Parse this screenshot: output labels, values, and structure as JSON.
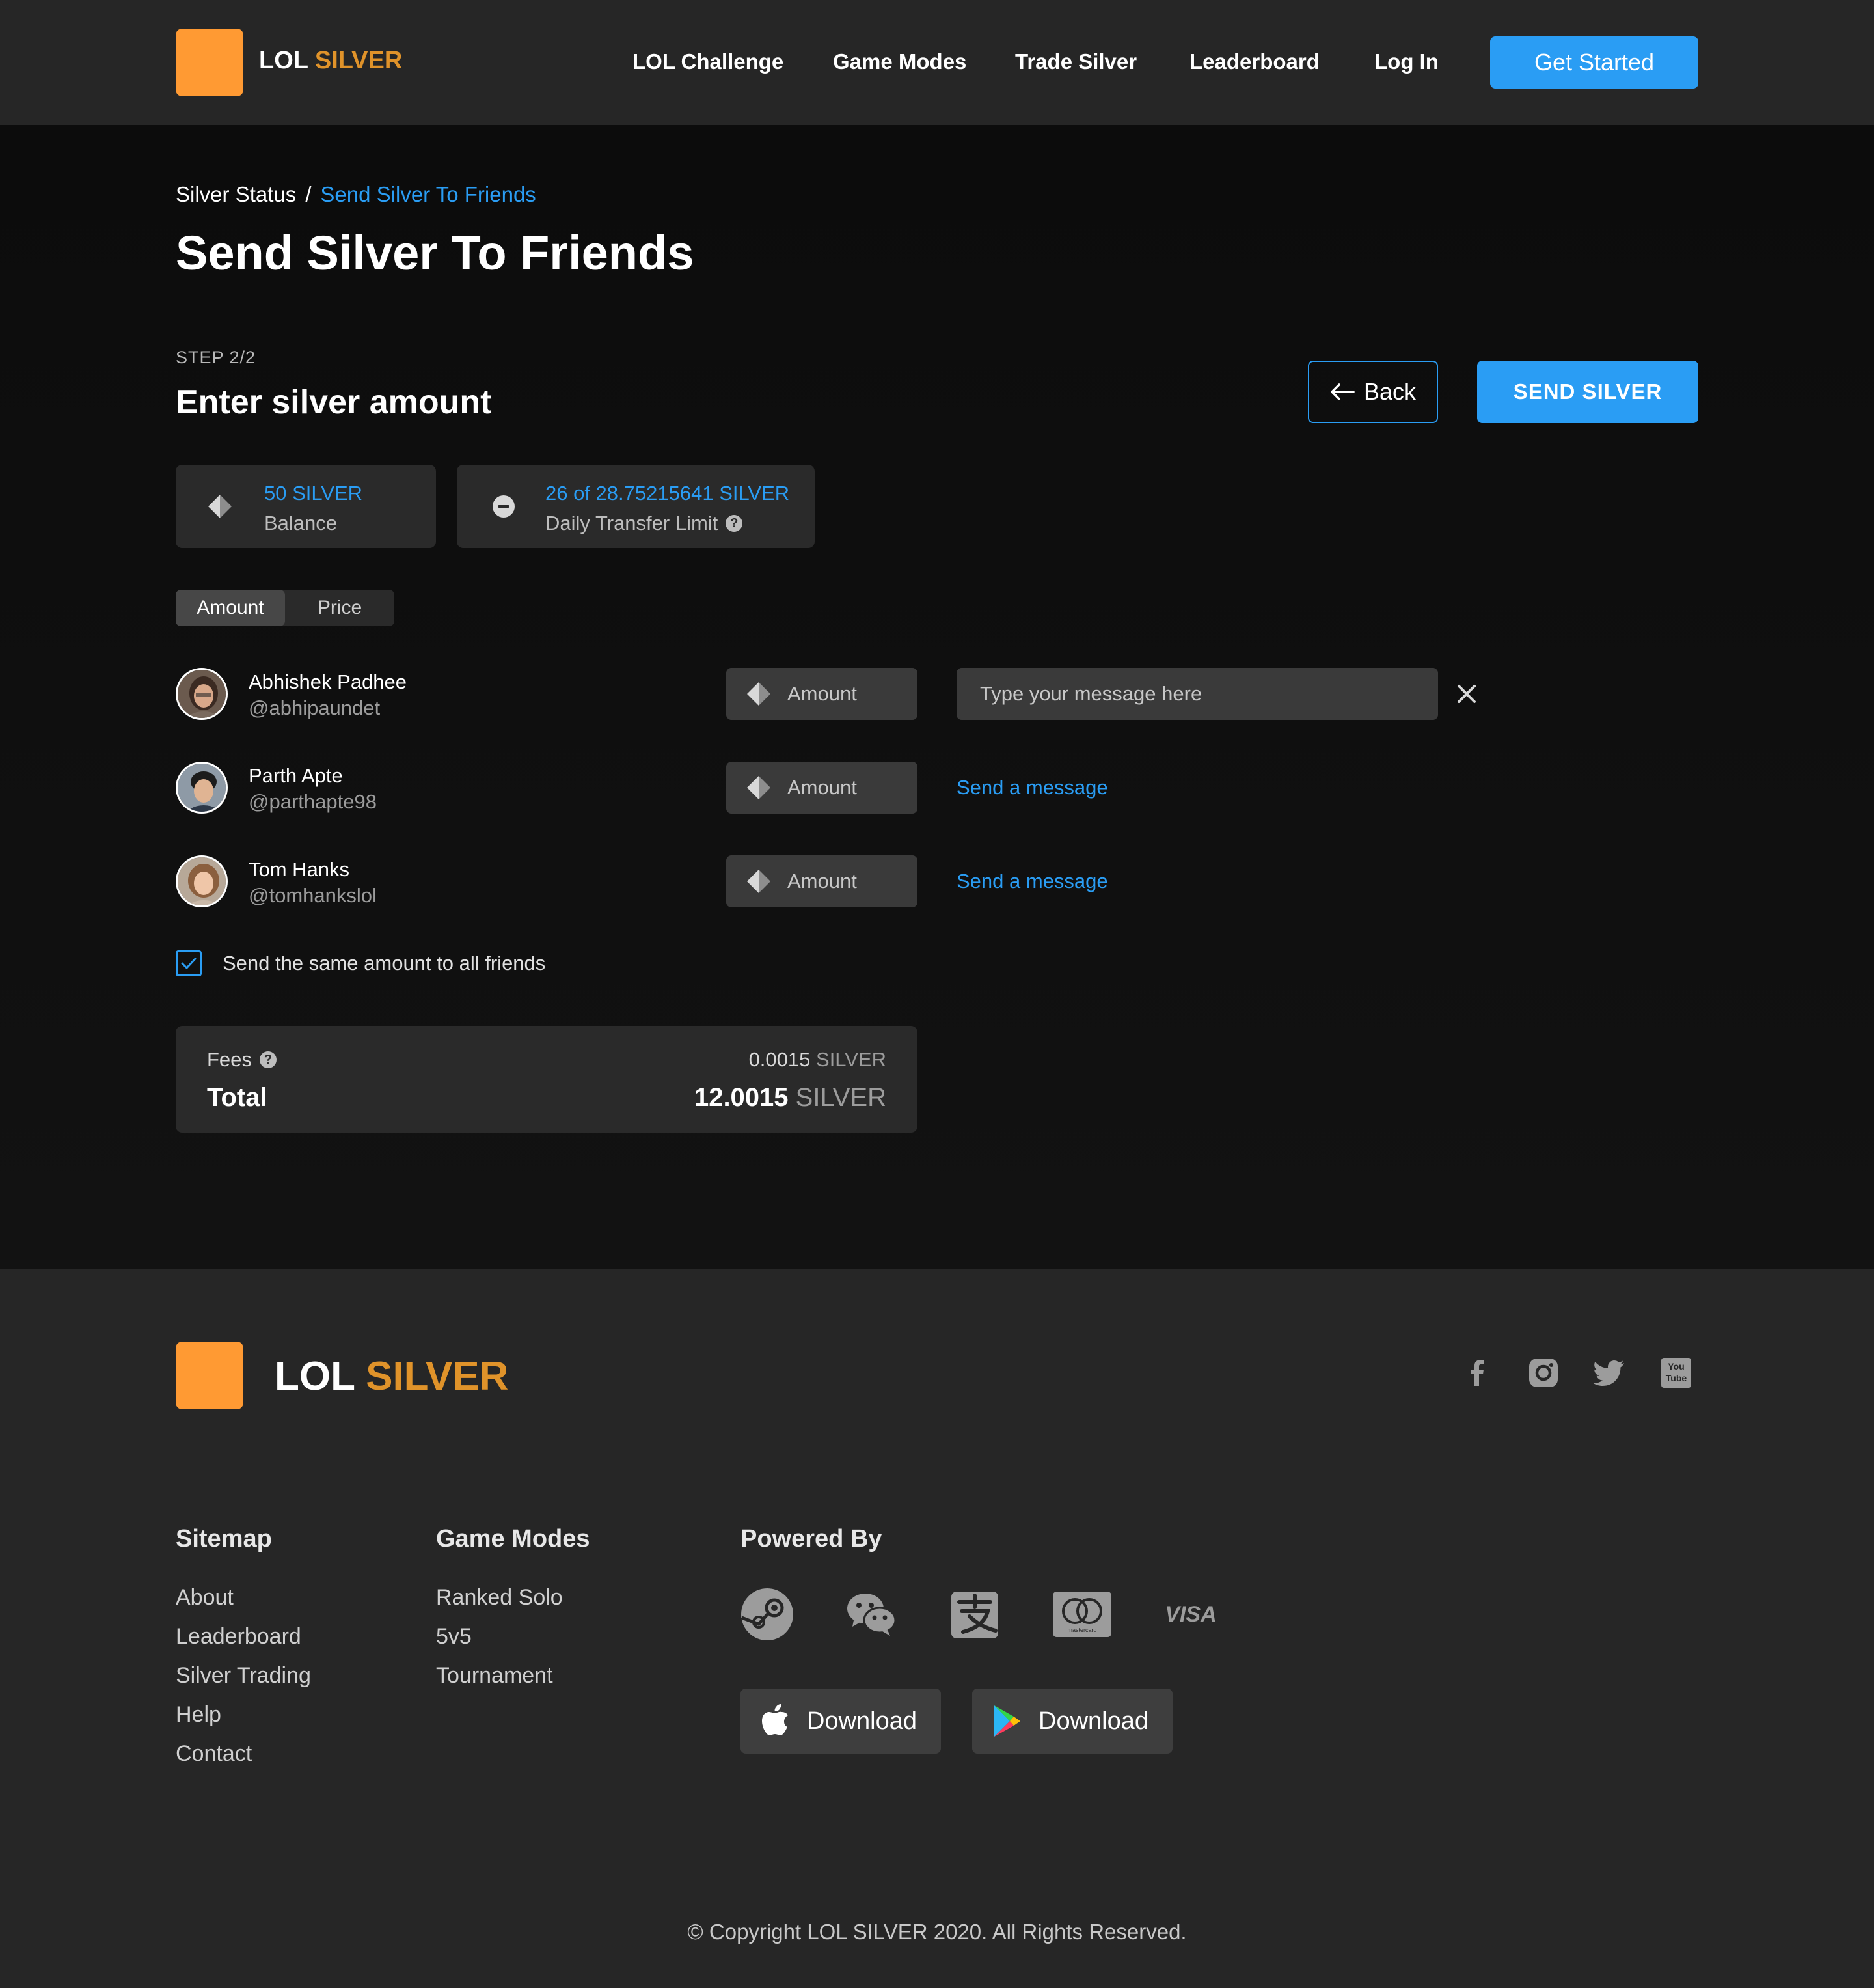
{
  "header": {
    "brand_part1": "LOL",
    "brand_part2": "SILVER",
    "nav": [
      "LOL Challenge",
      "Game Modes",
      "Trade Silver",
      "Leaderboard",
      "Log In"
    ],
    "cta": "Get Started"
  },
  "breadcrumb": {
    "parent": "Silver Status",
    "separator": "/",
    "current": "Send Silver To Friends"
  },
  "page_title": "Send Silver To Friends",
  "step": {
    "label": "STEP 2/2",
    "title": "Enter silver amount"
  },
  "actions": {
    "back": "Back",
    "send": "SEND SILVER"
  },
  "balance": {
    "value": "50 SILVER",
    "label": "Balance"
  },
  "limit": {
    "value": "26 of 28.75215641 SILVER",
    "label": "Daily Transfer Limit"
  },
  "mode_toggle": {
    "options": [
      "Amount",
      "Price"
    ],
    "selected": "Amount"
  },
  "friends": [
    {
      "name": "Abhishek Padhee",
      "handle": "@abhipaundet",
      "amount_placeholder": "Amount",
      "message_placeholder": "Type your message here"
    },
    {
      "name": "Parth Apte",
      "handle": "@parthapte98",
      "amount_placeholder": "Amount",
      "message_link": "Send a message"
    },
    {
      "name": "Tom Hanks",
      "handle": "@tomhankslol",
      "amount_placeholder": "Amount",
      "message_link": "Send a message"
    }
  ],
  "same_amount": {
    "label": "Send the same amount to all friends",
    "checked": true
  },
  "summary": {
    "fees_label": "Fees",
    "fees_value": "0.0015",
    "fees_unit": "SILVER",
    "total_label": "Total",
    "total_value": "12.0015",
    "total_unit": "SILVER"
  },
  "footer": {
    "brand_part1": "LOL",
    "brand_part2": "SILVER",
    "sitemap_title": "Sitemap",
    "sitemap": [
      "About",
      "Leaderboard",
      "Silver Trading",
      "Help",
      "Contact"
    ],
    "modes_title": "Game Modes",
    "modes": [
      "Ranked Solo",
      "5v5",
      "Tournament"
    ],
    "powered_title": "Powered By",
    "payments": [
      "steam-icon",
      "wechat-icon",
      "alipay-icon",
      "mastercard-icon",
      "visa-icon"
    ],
    "visa_text": "VISA",
    "mastercard_text": "mastercard",
    "youtube_text_1": "You",
    "youtube_text_2": "Tube",
    "download_ios": "Download",
    "download_android": "Download",
    "copyright": "© Copyright LOL SILVER 2020. All Rights Reserved."
  },
  "colors": {
    "accent": "#2a9df4",
    "brand_orange": "#ff9a33",
    "brand_text_orange": "#e0932a"
  }
}
